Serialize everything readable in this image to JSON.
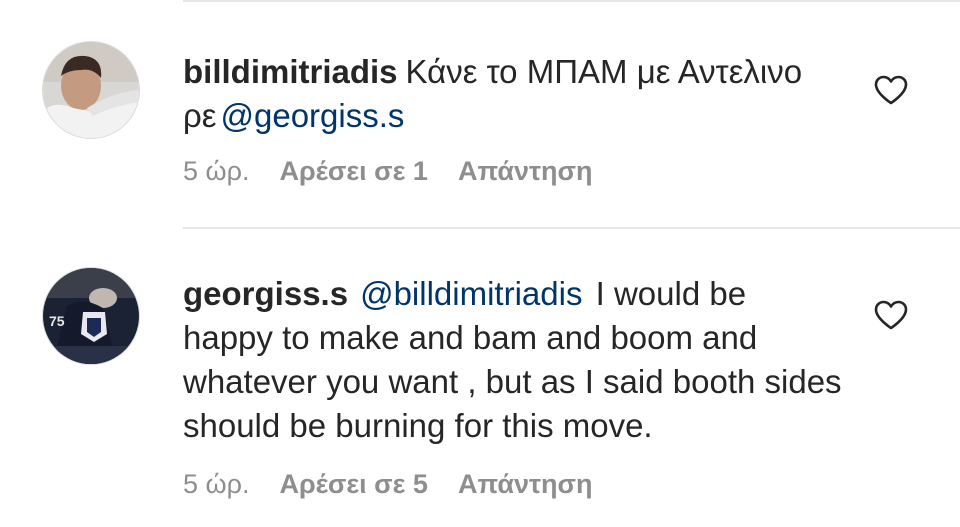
{
  "comments": [
    {
      "username": "billdimitriadis",
      "text_before": "Κάνε το ΜΠΑΜ με Αντελινο ρε",
      "mention": "@georgiss.s",
      "text_after": "",
      "time": "5 ώρ.",
      "likes": "Αρέσει σε 1",
      "reply": "Απάντηση",
      "icon": "heart-outline-icon"
    },
    {
      "username": "georgiss.s",
      "text_before": "",
      "mention": "@billdimitriadis",
      "text_after": "I would be happy to make and bam and boom and whatever you want , but as I said booth sides should be burning for this move.",
      "time": "5 ώρ.",
      "likes": "Αρέσει σε 5",
      "reply": "Απάντηση",
      "icon": "heart-outline-icon"
    }
  ],
  "colors": {
    "text": "#262626",
    "mention": "#003569",
    "meta": "#8e8e8e",
    "divider": "#e6e6e6"
  }
}
